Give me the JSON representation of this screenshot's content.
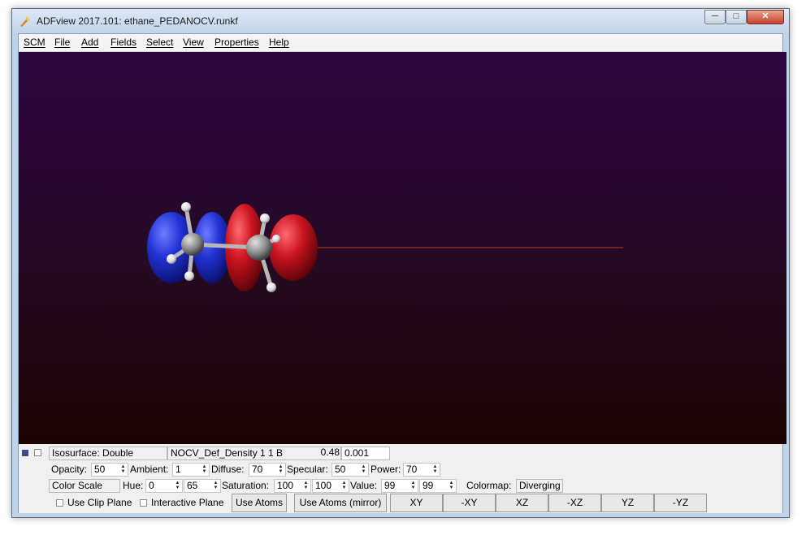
{
  "window": {
    "title": "ADFview 2017.101: ethane_PEDANOCV.runkf"
  },
  "menu": [
    "SCM",
    "File",
    "Add",
    "Fields",
    "Select",
    "View",
    "Properties",
    "Help"
  ],
  "panel": {
    "isosurface": "Isosurface: Double",
    "field_name": "NOCV_Def_Density 1 1 B",
    "value_a": "0.48",
    "value_b": "0.001",
    "opacity_label": "Opacity:",
    "opacity": "50",
    "ambient_label": "Ambient:",
    "ambient": "1",
    "diffuse_label": "Diffuse:",
    "diffuse": "70",
    "specular_label": "Specular:",
    "specular": "50",
    "power_label": "Power:",
    "power": "70",
    "color_scale": "Color Scale",
    "hue_label": "Hue:",
    "hue_a": "0",
    "hue_b": "65",
    "saturation_label": "Saturation:",
    "sat_a": "100",
    "sat_b": "100",
    "value_label": "Value:",
    "val_a": "99",
    "val_b": "99",
    "colormap_label": "Colormap:",
    "colormap": "Diverging",
    "use_clip_plane": "Use Clip Plane",
    "interactive_plane": "Interactive Plane",
    "use_atoms": "Use Atoms",
    "use_atoms_mirror": "Use Atoms (mirror)",
    "view_buttons": [
      "XY",
      "-XY",
      "XZ",
      "-XZ",
      "YZ",
      "-YZ"
    ]
  },
  "colors": {
    "lobe_blue": "#1f2fc8",
    "lobe_red": "#c8101a",
    "background_top": "#2b0840",
    "background_bottom": "#1a0402"
  }
}
